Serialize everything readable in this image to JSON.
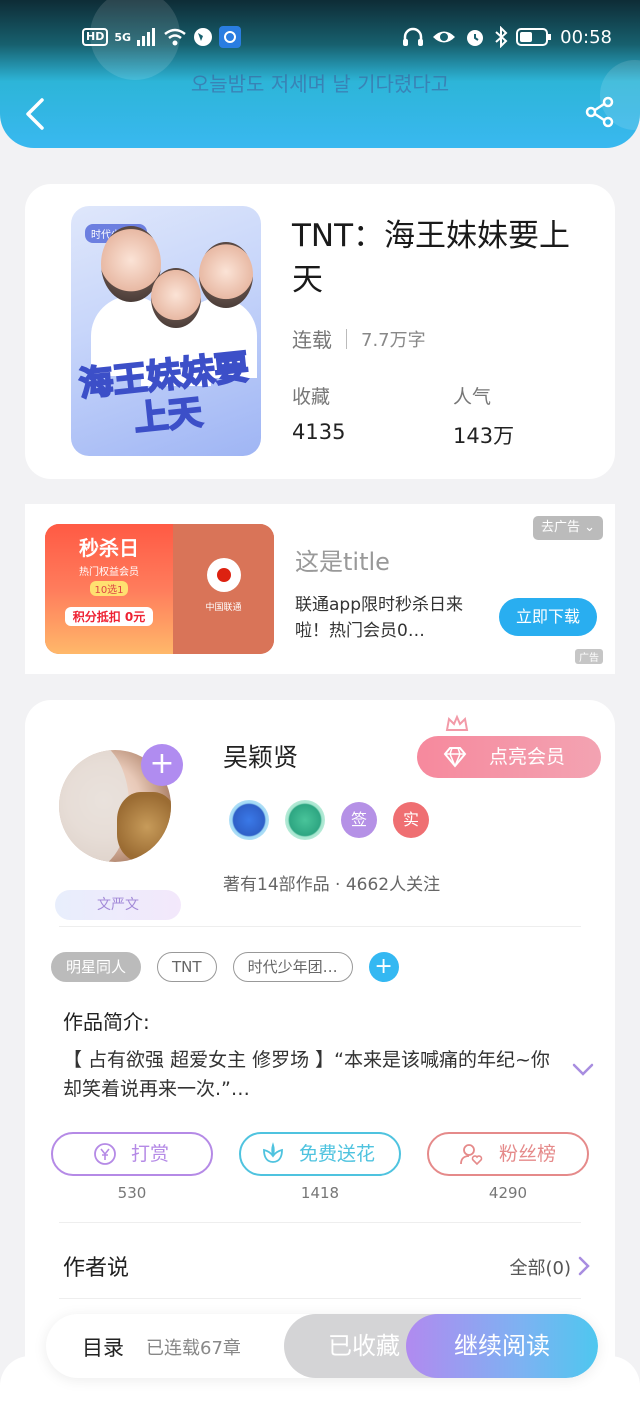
{
  "status_bar": {
    "network": "5G",
    "hd": "HD",
    "time": "00:58"
  },
  "header": {
    "marquee_text": "오늘밤도 저세며 날 기다렸다고"
  },
  "book": {
    "title": "TNT：海王妹妹要上天",
    "status": "连载",
    "word_count": "7.7万字",
    "collections_label": "收藏",
    "collections_value": "4135",
    "popularity_label": "人气",
    "popularity_value": "143万",
    "cover_title": "海王妹妹要上天",
    "cover_tag": "时代少年团"
  },
  "ad": {
    "image_title": "秒杀日",
    "image_sub": "热门权益会员",
    "image_badge": "10选1",
    "image_price": "积分抵扣 0元",
    "image_brand": "中国联通",
    "title": "这是title",
    "description": "联通app限时秒杀日来啦！热门会员0…",
    "close_label": "去广告",
    "download_label": "立即下载",
    "ad_mark": "广告"
  },
  "author": {
    "name": "吴颖贤",
    "badge": "文严文",
    "vip_label": "点亮会员",
    "badge_sign": "签",
    "badge_real": "实",
    "info": "著有14部作品 · 4662人关注",
    "accent": "#b08cf0"
  },
  "tags": [
    "明星同人",
    "TNT",
    "时代少年团…"
  ],
  "intro": {
    "label": "作品简介:",
    "text": "【 占有欲强 超爱女主 修罗场 】“本来是该喊痛的年纪~你却笑着说再来一次.”…"
  },
  "actions": [
    {
      "label": "打赏",
      "count": "530",
      "color": "#b58ae6"
    },
    {
      "label": "免费送花",
      "count": "1418",
      "color": "#4fc3df"
    },
    {
      "label": "粉丝榜",
      "count": "4290",
      "color": "#e58a8a"
    }
  ],
  "author_says": {
    "label": "作者说",
    "view_all": "全部(0)"
  },
  "bottom_bar": {
    "toc": "目录",
    "chapters": "已连载67章",
    "collected": "已收藏",
    "continue": "继续阅读"
  }
}
